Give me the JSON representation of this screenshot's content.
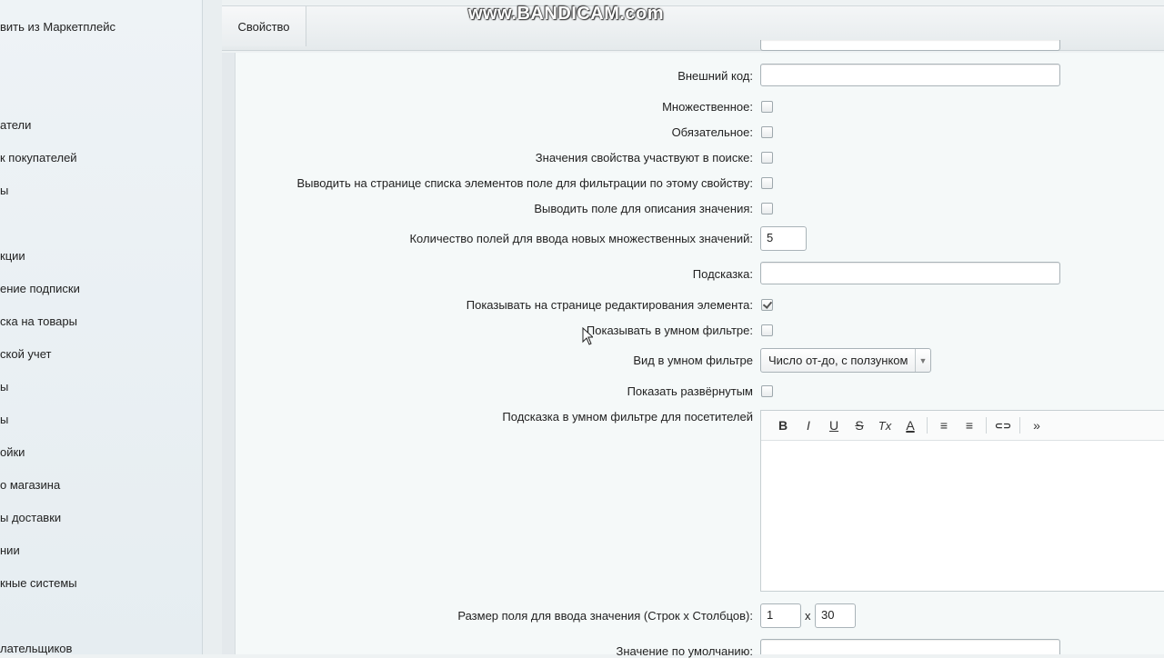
{
  "watermark": "www.BANDICAM.com",
  "sidebar": {
    "items": [
      "вить из Маркетплейс",
      "атели",
      "к покупателей",
      "ы",
      "кции",
      "ение подписки",
      "ска на товары",
      "ской учет",
      "ы",
      "ы",
      "ойки",
      "о магазина",
      "ы доставки",
      "нии",
      "кные системы",
      "",
      "лательщиков"
    ]
  },
  "tabs": [
    {
      "label": "Свойство"
    }
  ],
  "form": {
    "external_code_label": "Внешний код:",
    "multiple_label": "Множественное:",
    "required_label": "Обязательное:",
    "searchable_label": "Значения свойства участвуют в поиске:",
    "filter_list_label": "Выводить на странице списка элементов поле для фильтрации по этому свойству:",
    "description_field_label": "Выводить поле для описания значения:",
    "multiple_count_label": "Количество полей для ввода новых множественных значений:",
    "multiple_count_value": "5",
    "hint_label": "Подсказка:",
    "show_edit_label": "Показывать на странице редактирования элемента:",
    "show_smart_filter_label": "Показывать в умном фильтре:",
    "smart_filter_view_label": "Вид в умном фильтре",
    "smart_filter_view_value": "Число от-до, с ползунком",
    "show_expanded_label": "Показать развёрнутым",
    "smart_filter_hint_label": "Подсказка в умном фильтре для посетителей",
    "size_label": "Размер поля для ввода значения (Строк x Столбцов):",
    "rows_value": "1",
    "size_sep": "x",
    "cols_value": "30",
    "default_value_label": "Значение по умолчанию:"
  },
  "checkboxes": {
    "multiple": false,
    "required": false,
    "searchable": false,
    "filter_list": false,
    "description_field": false,
    "show_edit": true,
    "show_smart_filter": false,
    "show_expanded": false
  },
  "editor_toolbar": {
    "bold": "B",
    "italic": "I",
    "underline": "U",
    "strike": "S",
    "clear_format": "Tx",
    "font_color": "A",
    "ordered_list": "≡",
    "unordered_list": "≡",
    "link": "⊂⊃",
    "more": "»"
  }
}
